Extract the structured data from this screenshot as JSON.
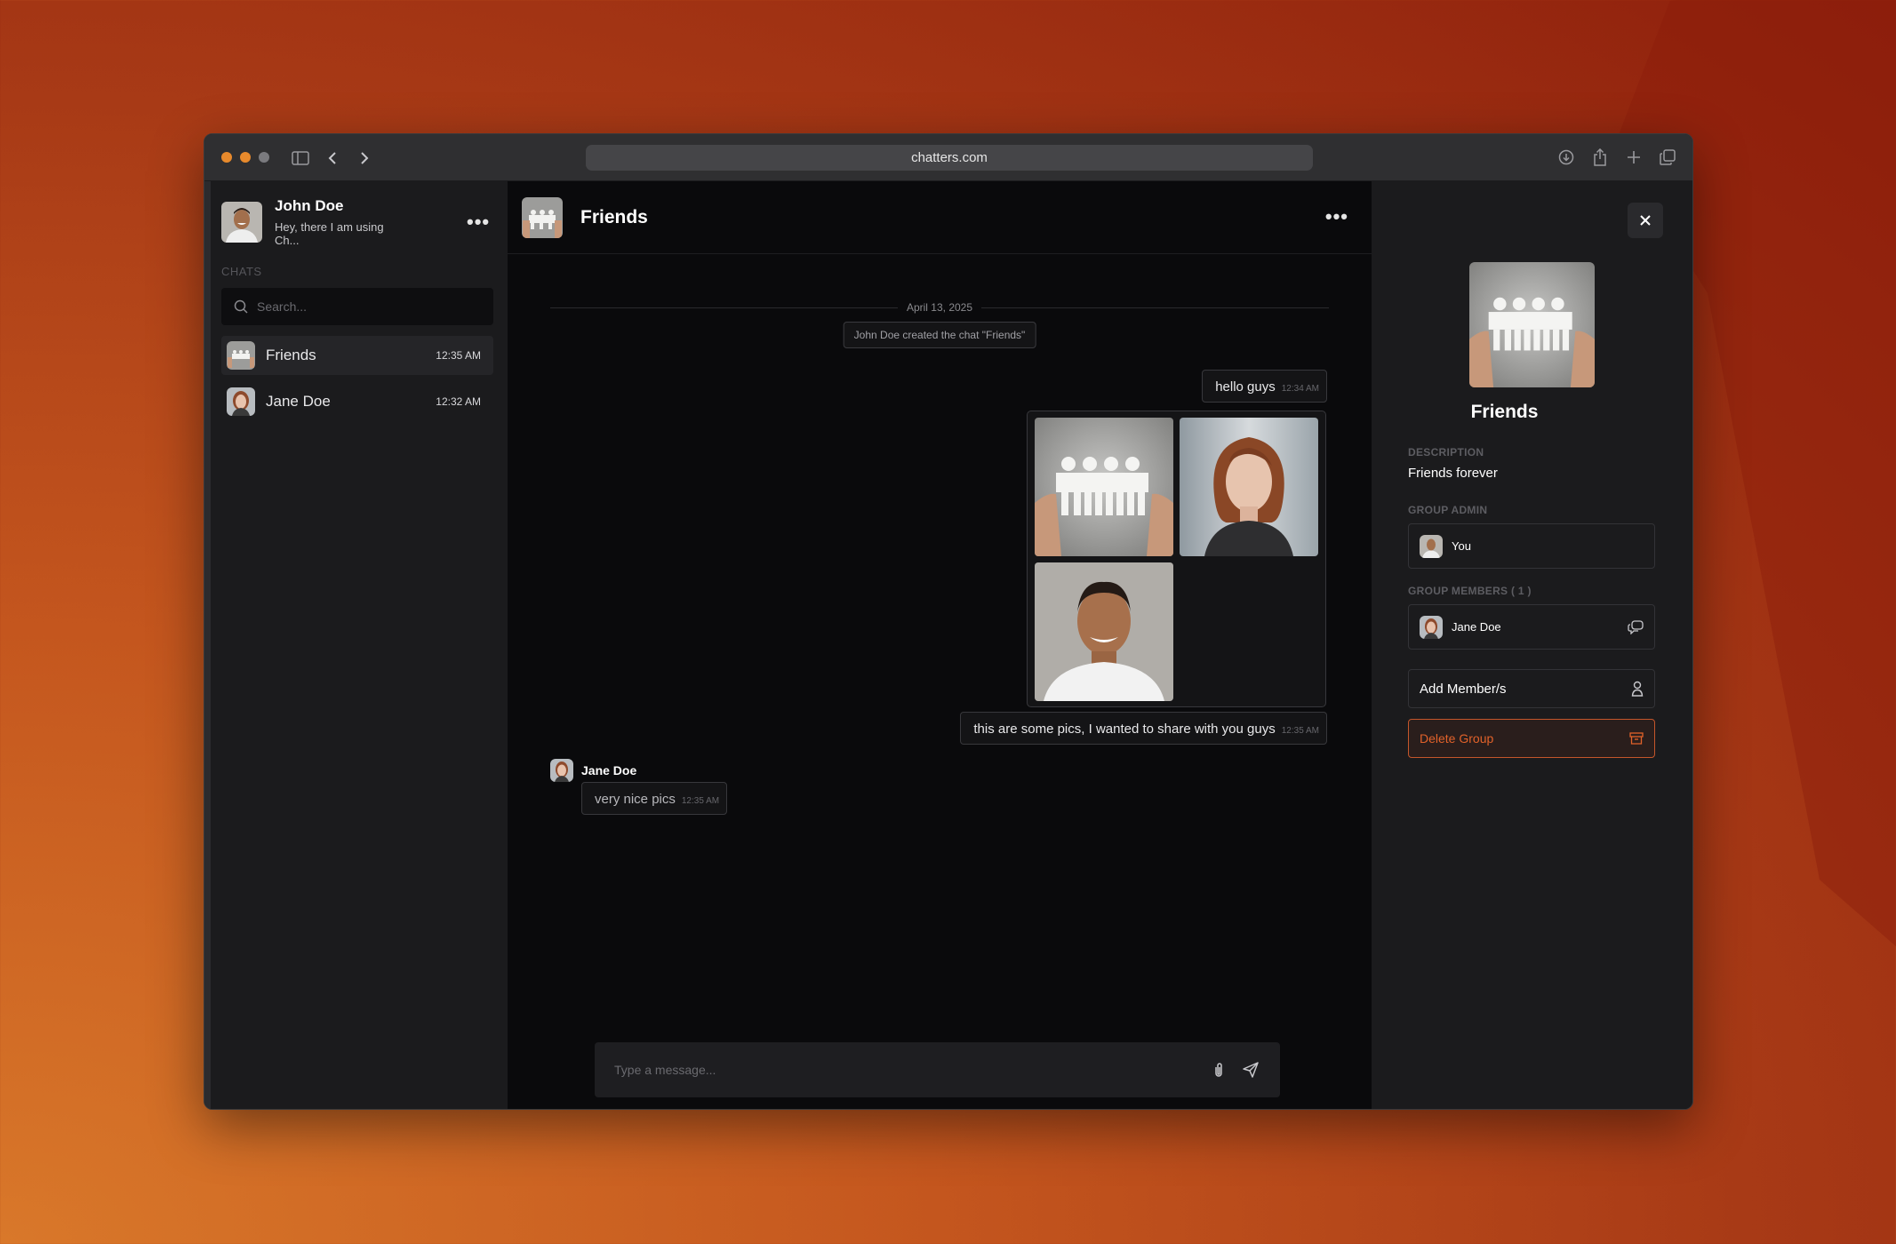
{
  "browser": {
    "url": "chatters.com",
    "traffic_lights": [
      "#e88a2c",
      "#e88a2c",
      "#7a7a7e"
    ]
  },
  "sidebar": {
    "user": {
      "name": "John Doe",
      "status": "Hey, there I am using Ch..."
    },
    "section_label": "CHATS",
    "search_placeholder": "Search...",
    "chats": [
      {
        "name": "Friends",
        "time": "12:35 AM"
      },
      {
        "name": "Jane Doe",
        "time": "12:32 AM"
      }
    ]
  },
  "main": {
    "title": "Friends",
    "date": "April 13, 2025",
    "system_message": "John Doe created the chat \"Friends\"",
    "messages": [
      {
        "text": "hello guys",
        "time": "12:34 AM"
      },
      {
        "text": "this are some pics, I wanted to share with you guys",
        "time": "12:35 AM"
      },
      {
        "sender": "Jane Doe",
        "text": "very nice pics",
        "time": "12:35 AM"
      }
    ],
    "composer_placeholder": "Type a message..."
  },
  "panel": {
    "group_name": "Friends",
    "description_label": "DESCRIPTION",
    "description": "Friends forever",
    "admin_label": "GROUP ADMIN",
    "admin": "You",
    "members_label": "GROUP MEMBERS ( 1 )",
    "members": [
      "Jane Doe"
    ],
    "add_member": "Add Member/s",
    "delete_group": "Delete Group"
  },
  "colors": {
    "accent": "#e2622a",
    "danger_border": "#c4562b"
  }
}
